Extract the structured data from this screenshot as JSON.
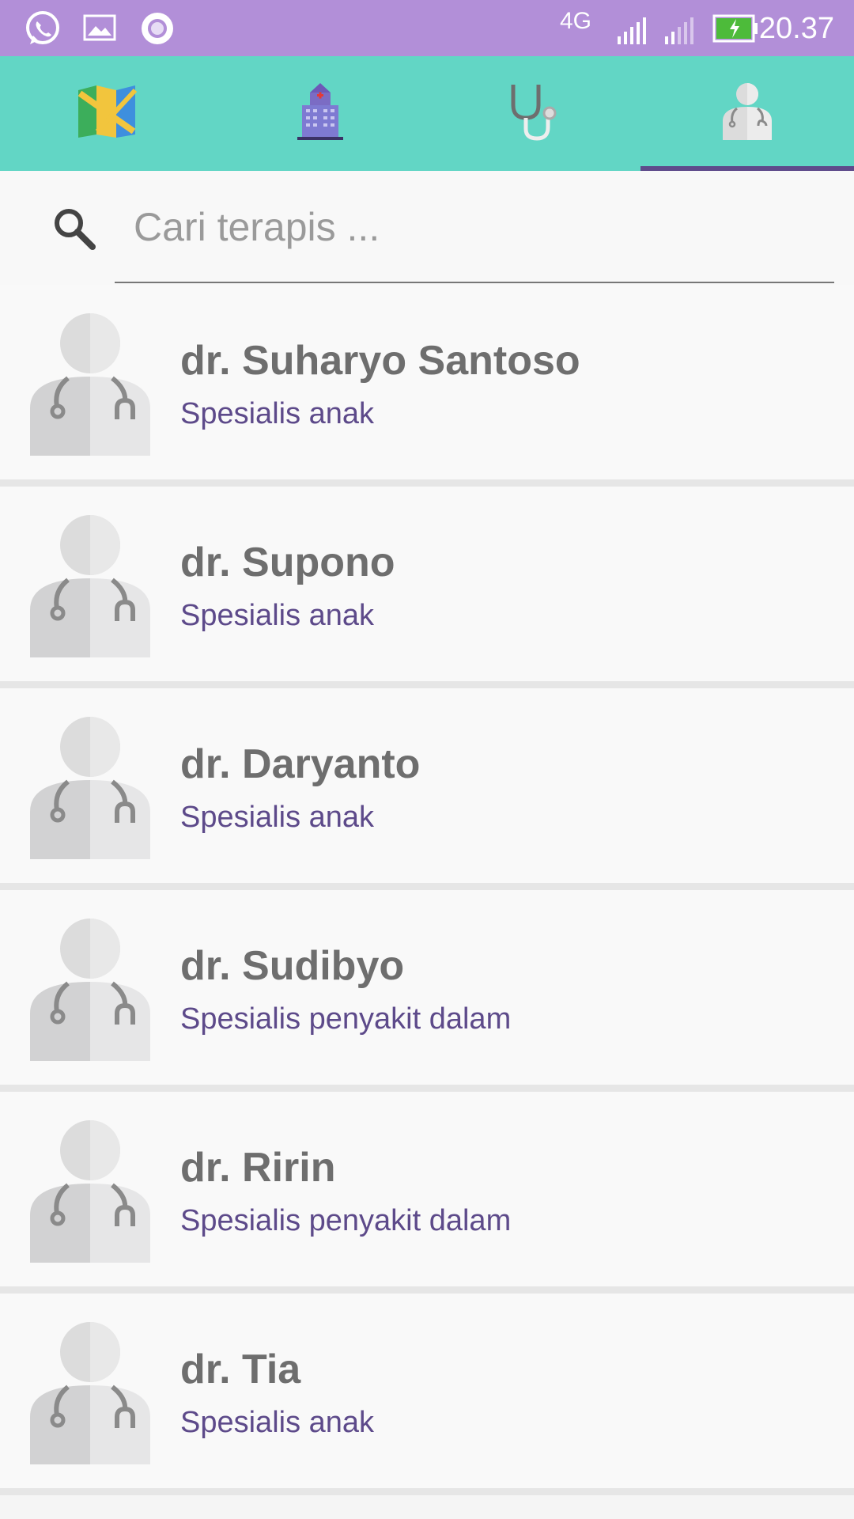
{
  "status_bar": {
    "network": "4G",
    "time": "20.37",
    "icons": [
      "whatsapp-icon",
      "gallery-icon",
      "circle-app-icon",
      "signal-1-icon",
      "signal-2-icon",
      "battery-charging-icon"
    ]
  },
  "tabs": [
    {
      "name": "map",
      "icon": "map-icon",
      "active": false
    },
    {
      "name": "hospital",
      "icon": "hospital-icon",
      "active": false
    },
    {
      "name": "stethoscope",
      "icon": "stethoscope-icon",
      "active": false
    },
    {
      "name": "doctor",
      "icon": "doctor-icon",
      "active": true
    }
  ],
  "search": {
    "placeholder": "Cari terapis ...",
    "value": ""
  },
  "doctors": [
    {
      "name": "dr. Suharyo Santoso",
      "specialty": "Spesialis anak"
    },
    {
      "name": "dr. Supono",
      "specialty": "Spesialis anak"
    },
    {
      "name": "dr. Daryanto",
      "specialty": "Spesialis anak"
    },
    {
      "name": "dr. Sudibyo",
      "specialty": "Spesialis penyakit dalam"
    },
    {
      "name": "dr. Ririn",
      "specialty": "Spesialis penyakit dalam"
    },
    {
      "name": "dr. Tia",
      "specialty": "Spesialis anak"
    }
  ],
  "colors": {
    "status_bar": "#b28fd8",
    "tab_bar": "#62d6c5",
    "tab_indicator": "#5e4b8b",
    "name_text": "#6e6e6e",
    "specialty_text": "#5d4a8a"
  }
}
